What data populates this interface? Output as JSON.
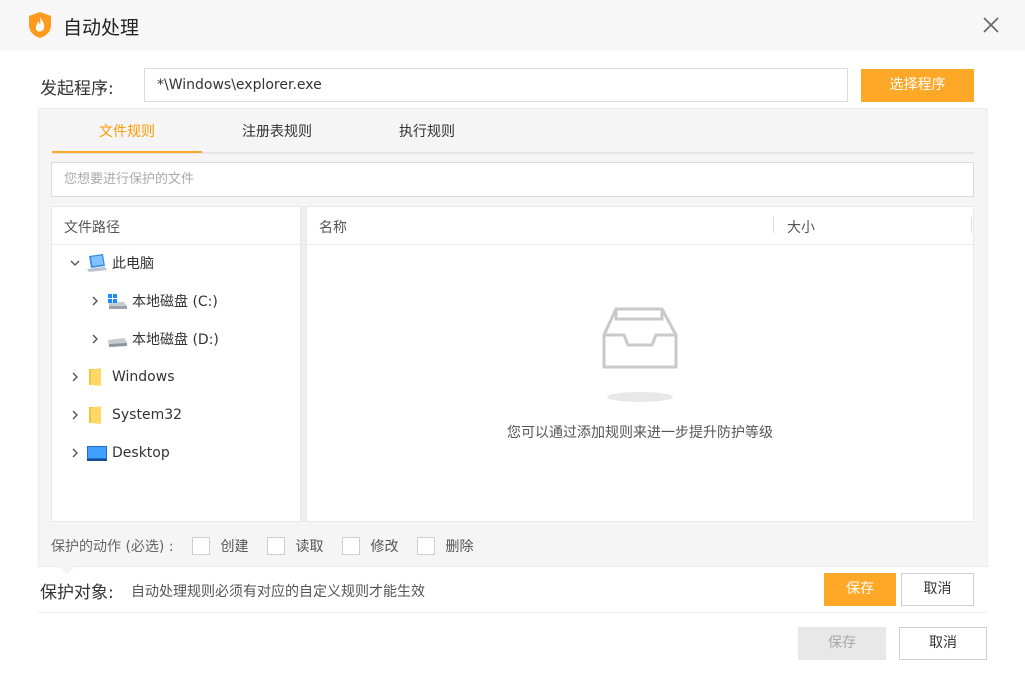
{
  "window": {
    "title": "自动处理",
    "logo_icon": "flame-shield-icon",
    "close_icon": "close-icon"
  },
  "launcher": {
    "label": "发起程序:",
    "value": "*\\Windows\\explorer.exe",
    "button": "选择程序"
  },
  "tabs": [
    {
      "label": "文件规则",
      "active": true
    },
    {
      "label": "注册表规则",
      "active": false
    },
    {
      "label": "执行规则",
      "active": false
    }
  ],
  "file_search": {
    "placeholder": "您想要进行保护的文件"
  },
  "tree": {
    "header": "文件路径",
    "items": [
      {
        "label": "此电脑",
        "icon": "computer-icon",
        "expanded": true
      },
      {
        "label": "本地磁盘 (C:)",
        "icon": "system-drive-icon",
        "expanded": false
      },
      {
        "label": "本地磁盘 (D:)",
        "icon": "drive-icon",
        "expanded": false
      },
      {
        "label": "Windows",
        "icon": "folder-icon",
        "expanded": false
      },
      {
        "label": "System32",
        "icon": "folder-icon",
        "expanded": false
      },
      {
        "label": "Desktop",
        "icon": "desktop-icon",
        "expanded": false
      }
    ]
  },
  "files": {
    "col_name": "名称",
    "col_size": "大小",
    "empty_icon": "empty-tray-icon",
    "empty_text": "您可以通过添加规则来进一步提升防护等级"
  },
  "actions": {
    "label": "保护的动作 (必选) :",
    "options": [
      {
        "label": "创建",
        "checked": false
      },
      {
        "label": "读取",
        "checked": false
      },
      {
        "label": "修改",
        "checked": false
      },
      {
        "label": "删除",
        "checked": false
      }
    ]
  },
  "protect": {
    "label": "保护对象:",
    "note": "自动处理规则必须有对应的自定义规则才能生效",
    "save": "保存",
    "cancel": "取消"
  },
  "footer": {
    "save": "保存",
    "cancel": "取消",
    "save_disabled": true
  },
  "colors": {
    "accent": "#ffa727",
    "active_tab": "#ff9a00",
    "panel_bg": "#f5f5f5"
  }
}
